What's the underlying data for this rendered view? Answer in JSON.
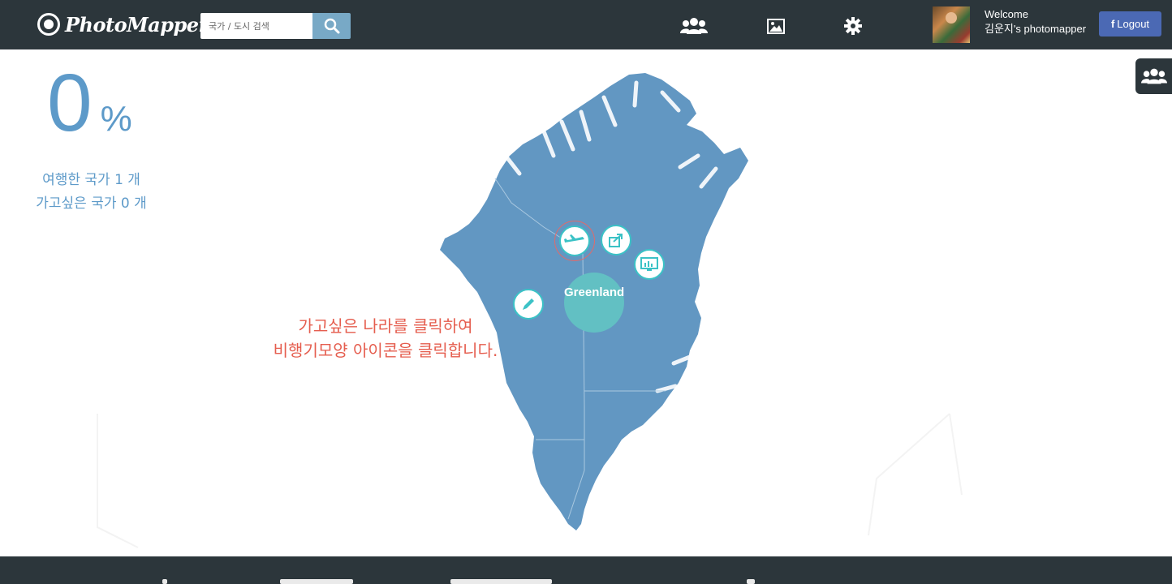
{
  "app": {
    "name": "PhotoMapper",
    "search_placeholder": "국가 / 도시 검색"
  },
  "header": {
    "nav_icons": [
      "friends-icon",
      "photo-icon",
      "gear-icon"
    ],
    "welcome_line": "Welcome",
    "user_line": "김운지's photomapper",
    "logout_label": "Logout",
    "logout_prefix": "f"
  },
  "stats": {
    "percent_value": "0",
    "percent_sign": "%",
    "visited_line": "여행한 국가 1 개",
    "wish_line": "가고싶은 국가 0 개"
  },
  "hint": {
    "line1": "가고싶은 나라를 클릭하여",
    "line2": "비행기모양 아이콘을 클릭합니다."
  },
  "map": {
    "country_label": "Greenland",
    "land_color": "#6297c2",
    "bubble_color": "#62c0c3",
    "action_icons": [
      "airplane-icon",
      "share-icon",
      "chart-icon",
      "pencil-icon"
    ]
  },
  "colors": {
    "topbar": "#2c363b",
    "accent_blue": "#5d9ac9",
    "hint_red": "#e55d4e",
    "facebook_blue": "#4b69b4",
    "search_button": "#78a9c6"
  }
}
